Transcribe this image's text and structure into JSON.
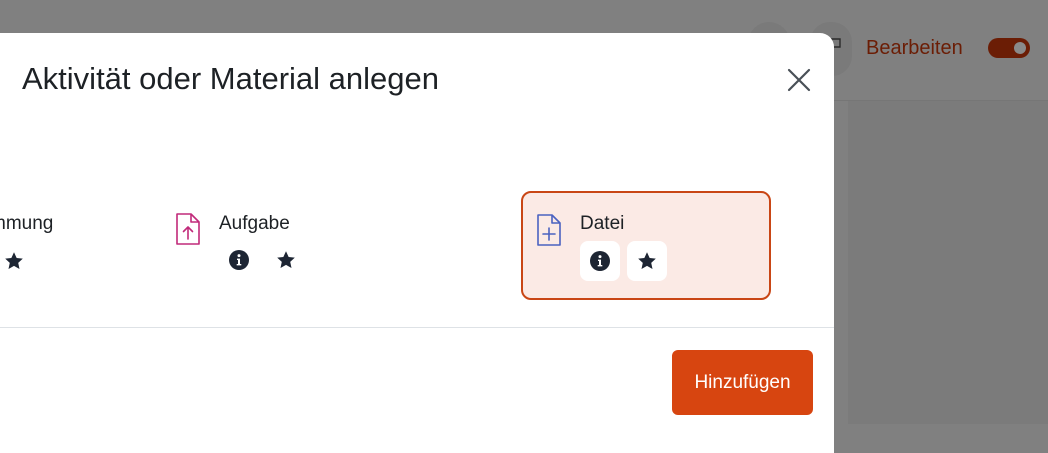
{
  "header": {
    "edit_label": "Bearbeiten",
    "edit_mode_on": true
  },
  "modal": {
    "title": "Aktivität oder Material anlegen",
    "items": [
      {
        "label": "mmung"
      },
      {
        "label": "Aufgabe",
        "icon": "file-upload-icon",
        "icon_color": "#c12a7a"
      },
      {
        "label": "Datei",
        "icon": "file-plus-icon",
        "icon_color": "#4b62c0",
        "selected": true
      }
    ],
    "add_button_label": "Hinzufügen"
  },
  "colors": {
    "accent": "#d74510",
    "selected_bg": "#fbeae5",
    "text": "#1d2125",
    "overlay": "#808080"
  }
}
